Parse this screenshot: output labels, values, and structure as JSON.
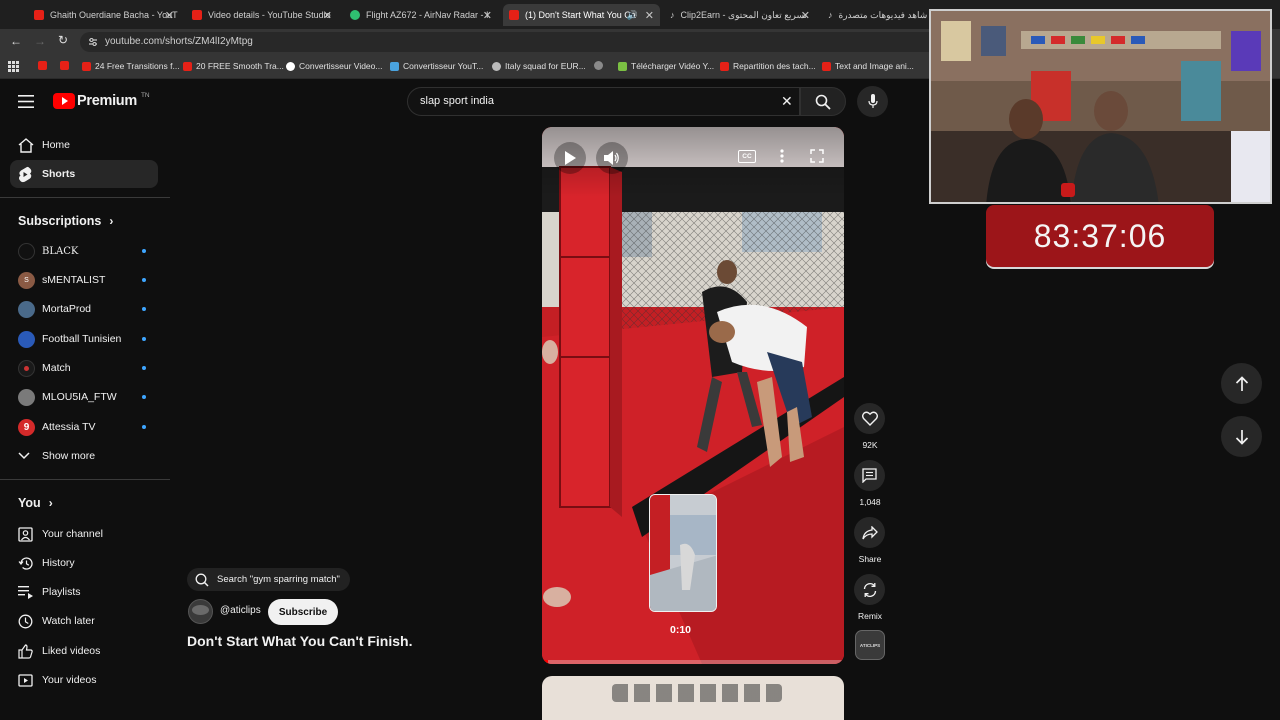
{
  "browser": {
    "tabs": [
      {
        "title": "Ghaith Ouerdiane Bacha - YouT",
        "active": false
      },
      {
        "title": "Video details - YouTube Studio",
        "active": false
      },
      {
        "title": "Flight AZ672 - AirNav Radar - I",
        "active": false
      },
      {
        "title": "(1) Don't Start What You Ca",
        "active": true
      },
      {
        "title": "Clip2Earn - تسريع تعاون المحتوى",
        "active": false
      },
      {
        "title": "شاهد فيديوهات متصدرة |",
        "active": false
      }
    ],
    "url": "youtube.com/shorts/ZM4lI2yMtpg",
    "bookmarks": [
      "24 Free Transitions f...",
      "20 FREE Smooth Tra...",
      "Convertisseur Video...",
      "Convertisseur YouT...",
      "Italy squad for EUR...",
      "Télécharger Vidéo Y...",
      "Repartition des tach...",
      "Text and Image ani..."
    ]
  },
  "header": {
    "logo": "Premium",
    "country": "TN",
    "search_value": "slap sport india"
  },
  "sidebar": {
    "main": [
      {
        "label": "Home",
        "icon": "home-icon",
        "active": false
      },
      {
        "label": "Shorts",
        "icon": "shorts-icon",
        "active": true
      }
    ],
    "subscriptions_title": "Subscriptions",
    "subscriptions": [
      {
        "label": "BLACK",
        "color": "#111111",
        "letter": ""
      },
      {
        "label": "sMENTALIST",
        "color": "#8a5a44",
        "letter": "S"
      },
      {
        "label": "MortaProd",
        "color": "#4a6a8a",
        "letter": ""
      },
      {
        "label": "Football Tunisien",
        "color": "#2a5ab8",
        "letter": ""
      },
      {
        "label": "Match",
        "color": "#1a1a1a",
        "letter": ""
      },
      {
        "label": "MLOU5IA_FTW",
        "color": "#7a7a7a",
        "letter": ""
      },
      {
        "label": "Attessia TV",
        "color": "#d42a2a",
        "letter": "9"
      }
    ],
    "show_more": "Show more",
    "you_title": "You",
    "you": [
      {
        "label": "Your channel",
        "icon": "your-channel-icon"
      },
      {
        "label": "History",
        "icon": "history-icon"
      },
      {
        "label": "Playlists",
        "icon": "playlists-icon"
      },
      {
        "label": "Watch later",
        "icon": "watch-later-icon"
      },
      {
        "label": "Liked videos",
        "icon": "liked-videos-icon"
      },
      {
        "label": "Your videos",
        "icon": "your-videos-icon"
      }
    ]
  },
  "short": {
    "search_suggestion": "Search \"gym sparring match\"",
    "channel": "@aticlips",
    "subscribe_label": "Subscribe",
    "title": "Don't Start What You Can't Finish.",
    "preview_time": "0:10",
    "likes": "92K",
    "comments": "1,048",
    "share_label": "Share",
    "remix_label": "Remix",
    "channel_avatar_text": "ATICLIPS",
    "progress": 0.02
  },
  "overlay": {
    "timer": "83:37:06"
  }
}
